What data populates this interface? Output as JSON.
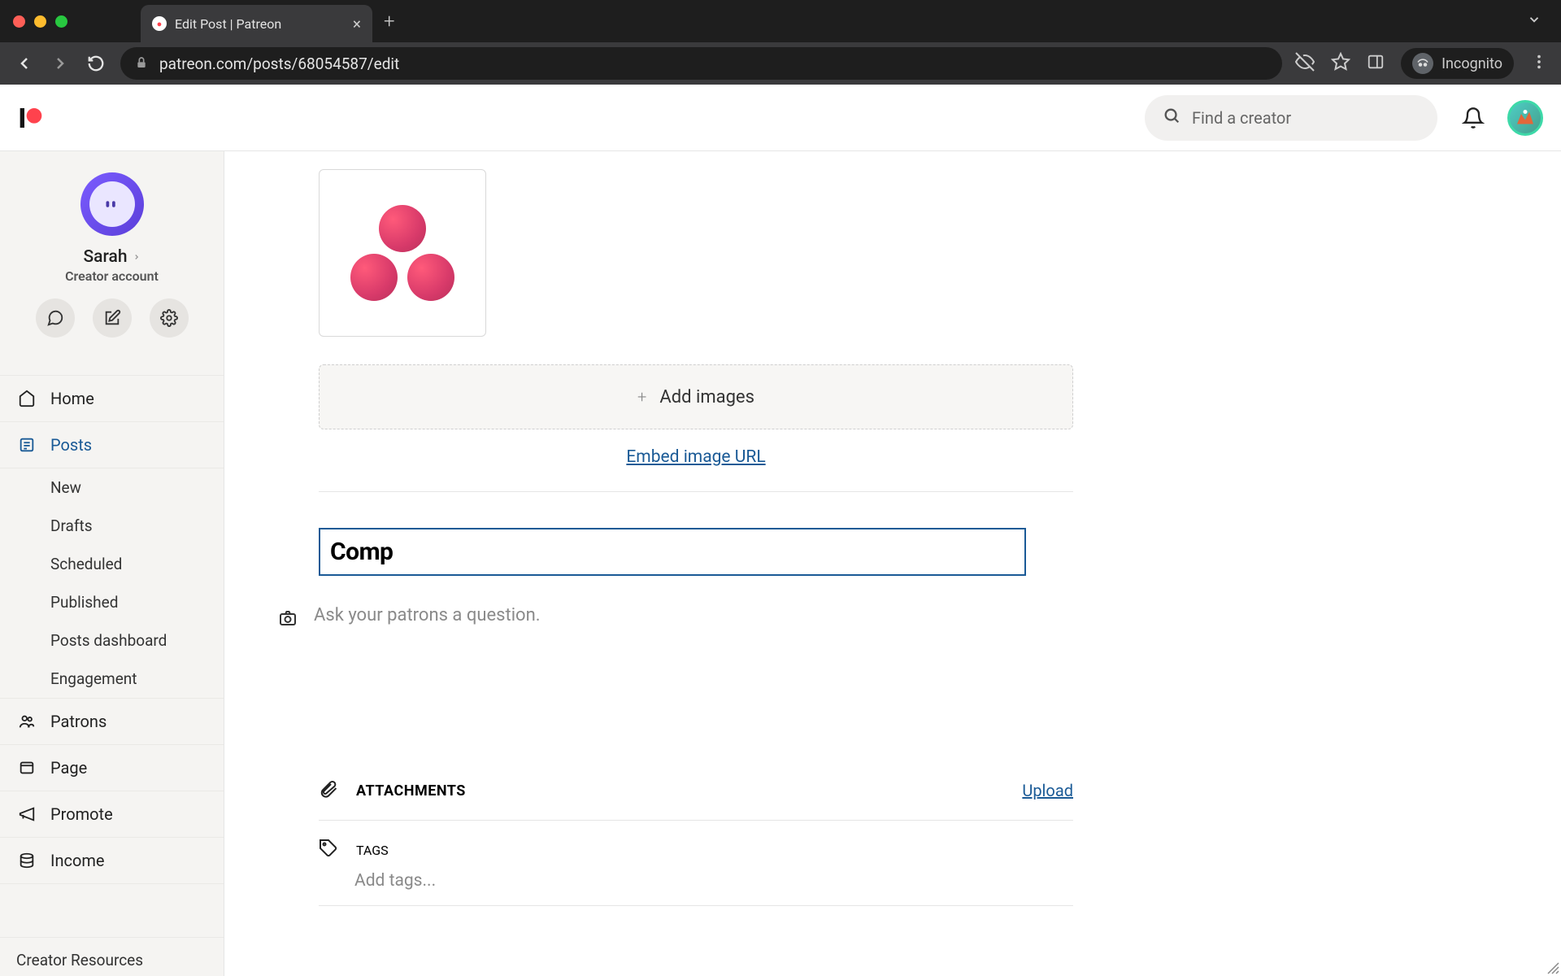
{
  "browser": {
    "tab_title": "Edit Post | Patreon",
    "url": "patreon.com/posts/68054587/edit",
    "incognito_label": "Incognito"
  },
  "header": {
    "search_placeholder": "Find a creator"
  },
  "sidebar": {
    "creator_name": "Sarah",
    "creator_sub": "Creator account",
    "nav": {
      "home": "Home",
      "posts": "Posts",
      "patrons": "Patrons",
      "page": "Page",
      "promote": "Promote",
      "income": "Income"
    },
    "posts_sub": {
      "new": "New",
      "drafts": "Drafts",
      "scheduled": "Scheduled",
      "published": "Published",
      "dashboard": "Posts dashboard",
      "engagement": "Engagement"
    },
    "footer": "Creator Resources"
  },
  "main": {
    "add_images": "Add images",
    "embed_link": "Embed image URL",
    "title_value": "Comp",
    "body_placeholder": "Ask your patrons a question.",
    "attachments_label": "ATTACHMENTS",
    "upload_label": "Upload",
    "tags_label": "TAGS",
    "tags_placeholder": "Add tags..."
  },
  "colors": {
    "accent": "#1a5a96"
  }
}
